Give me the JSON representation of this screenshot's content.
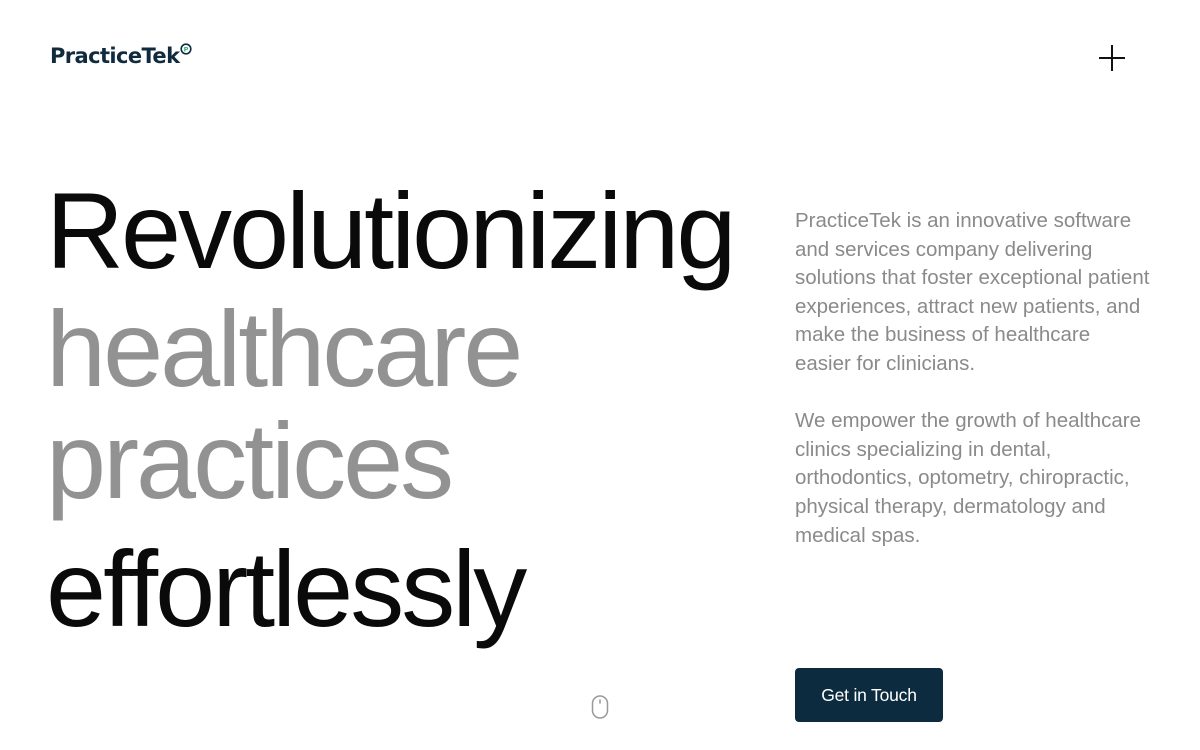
{
  "header": {
    "logo_text": "PracticeTek",
    "logo_mark_letter": "P",
    "brand_accent_color": "#2bb673",
    "brand_dark_color": "#0d2b3e",
    "menu_icon": "plus-icon"
  },
  "hero": {
    "headline_line1": "Revolutionizing",
    "headline_line2": "healthcare",
    "headline_line3": "practices",
    "headline_line4": "effortlessly",
    "paragraph1": "PracticeTek is an innovative software and services company delivering solutions that foster exceptional patient experiences, attract new patients, and make the business of healthcare easier for clinicians.",
    "paragraph2": "We empower the growth of healthcare clinics specializing in dental, orthodontics, optometry, chiropractic, physical therapy, dermatology and medical spas.",
    "cta_label": "Get in Touch",
    "scroll_icon": "mouse-scroll-icon"
  }
}
